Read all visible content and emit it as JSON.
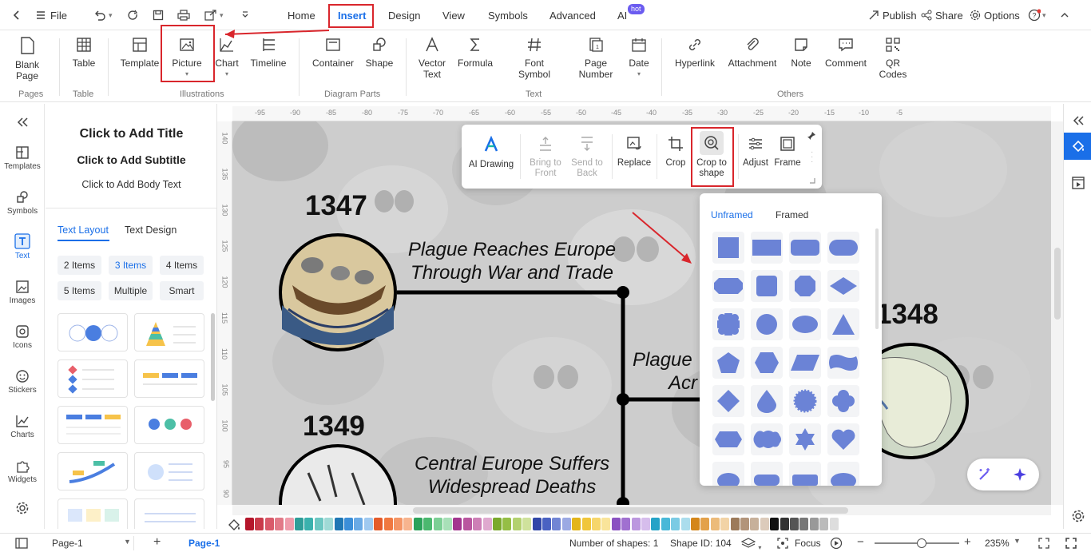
{
  "titlebar": {
    "file": "File",
    "tabs": [
      "Home",
      "Insert",
      "Design",
      "View",
      "Symbols",
      "Advanced",
      "AI"
    ],
    "hot_badge": "hot",
    "publish": "Publish",
    "share": "Share",
    "options": "Options"
  },
  "ribbon": {
    "blank_page": "Blank Page",
    "table": "Table",
    "template": "Template",
    "picture": "Picture",
    "chart": "Chart",
    "timeline": "Timeline",
    "container": "Container",
    "shape": "Shape",
    "vector_text": "Vector Text",
    "formula": "Formula",
    "font_symbol": "Font Symbol",
    "page_number": "Page Number",
    "date": "Date",
    "hyperlink": "Hyperlink",
    "attachment": "Attachment",
    "note": "Note",
    "comment": "Comment",
    "qr_codes": "QR Codes",
    "groups": [
      "Pages",
      "Table",
      "Illustrations",
      "Diagram Parts",
      "Text",
      "Others"
    ]
  },
  "leftbar": [
    "Templates",
    "Symbols",
    "Text",
    "Images",
    "Icons",
    "Stickers",
    "Charts",
    "Widgets"
  ],
  "panel": {
    "title": "Click to Add Title",
    "subtitle": "Click to Add Subtitle",
    "body": "Click to Add Body Text",
    "tab_layout": "Text Layout",
    "tab_design": "Text Design",
    "chips": [
      "2 Items",
      "3 Items",
      "4 Items",
      "5 Items",
      "Multiple",
      "Smart"
    ]
  },
  "ruler_h": [
    "-95",
    "-90",
    "-85",
    "-80",
    "-75",
    "-70",
    "-65",
    "-60",
    "-55",
    "-50",
    "-45",
    "-40",
    "-35",
    "-30",
    "-25",
    "-20",
    "-15",
    "-10",
    "-5"
  ],
  "ruler_v": [
    "140",
    "135",
    "130",
    "125",
    "120",
    "115",
    "110",
    "105",
    "100",
    "95",
    "90"
  ],
  "floatbar": {
    "ai_drawing": "AI Drawing",
    "bring_front": "Bring to Front",
    "send_back": "Send to Back",
    "replace": "Replace",
    "crop": "Crop",
    "crop_shape": "Crop to shape",
    "adjust": "Adjust",
    "frame": "Frame"
  },
  "shapepop": {
    "tab_unframed": "Unframed",
    "tab_framed": "Framed"
  },
  "canvas": {
    "year1": "1347",
    "event1_line1": "Plague Reaches Europe",
    "event1_line2": "Through War and Trade",
    "year2": "1348",
    "event2_line1": "Plague",
    "event2_line2": "Acr",
    "year3": "1349",
    "event3_line1": "Central Europe Suffers",
    "event3_line2": "Widespread Deaths"
  },
  "colors": {
    "accent": "#1a6fe8",
    "highlight": "#d9262c",
    "shape_fill": "#6b83d6"
  },
  "statusbar": {
    "page_select": "Page-1",
    "page_tab": "Page-1",
    "shapes_count": "Number of shapes: 1",
    "shape_id": "Shape ID: 104",
    "focus": "Focus",
    "zoom": "235%"
  }
}
